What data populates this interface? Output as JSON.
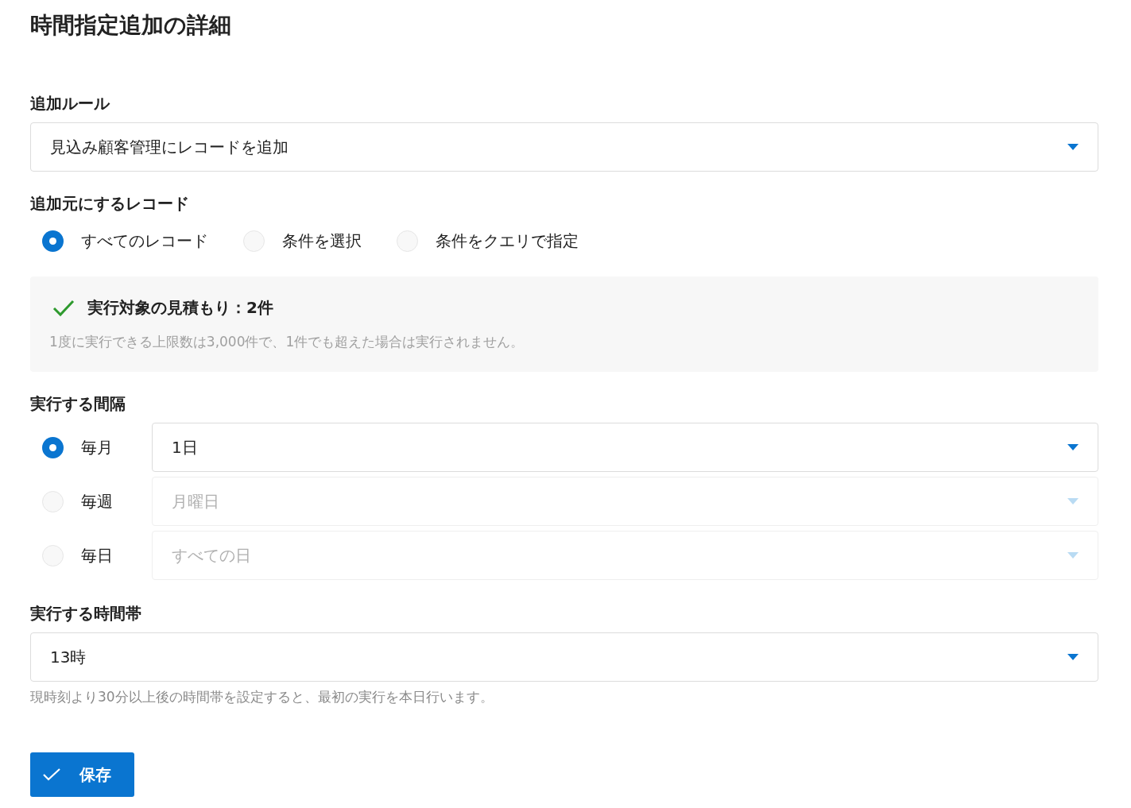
{
  "title": "時間指定追加の詳細",
  "rule": {
    "label": "追加ルール",
    "value": "見込み顧客管理にレコードを追加"
  },
  "source": {
    "label": "追加元にするレコード",
    "options": [
      {
        "label": "すべてのレコード",
        "selected": true
      },
      {
        "label": "条件を選択",
        "selected": false
      },
      {
        "label": "条件をクエリで指定",
        "selected": false
      }
    ]
  },
  "estimate": {
    "title": "実行対象の見積もり：2件",
    "note": "1度に実行できる上限数は3,000件で、1件でも超えた場合は実行されません。"
  },
  "interval": {
    "label": "実行する間隔",
    "options": [
      {
        "label": "毎月",
        "selected": true,
        "value": "1日",
        "disabled": false
      },
      {
        "label": "毎週",
        "selected": false,
        "value": "月曜日",
        "disabled": true
      },
      {
        "label": "毎日",
        "selected": false,
        "value": "すべての日",
        "disabled": true
      }
    ]
  },
  "time": {
    "label": "実行する時間帯",
    "value": "13時",
    "hint": "現時刻より30分以上後の時間帯を設定すると、最初の実行を本日行います。"
  },
  "save_button": {
    "label": "保存"
  }
}
